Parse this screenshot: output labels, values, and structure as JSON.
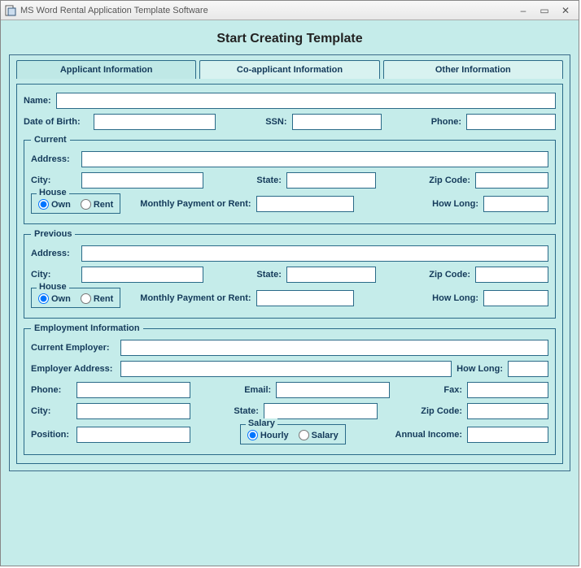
{
  "window_title": "MS Word Rental Application Template Software",
  "heading": "Start Creating Template",
  "tabs": {
    "applicant": "Applicant Information",
    "coapplicant": "Co-applicant Information",
    "other": "Other Information"
  },
  "section_top": {
    "name_label": "Name:",
    "dob_label": "Date of Birth:",
    "ssn_label": "SSN:",
    "phone_label": "Phone:"
  },
  "current": {
    "legend": "Current",
    "address_label": "Address:",
    "city_label": "City:",
    "state_label": "State:",
    "zip_label": "Zip Code:",
    "house_legend": "House",
    "own_label": "Own",
    "rent_label": "Rent",
    "monthly_label": "Monthly Payment or Rent:",
    "howlong_label": "How Long:"
  },
  "previous": {
    "legend": "Previous",
    "address_label": "Address:",
    "city_label": "City:",
    "state_label": "State:",
    "zip_label": "Zip Code:",
    "house_legend": "House",
    "own_label": "Own",
    "rent_label": "Rent",
    "monthly_label": "Monthly Payment or Rent:",
    "howlong_label": "How Long:"
  },
  "employment": {
    "legend": "Employment Information",
    "employer_label": "Current Employer:",
    "emp_address_label": "Employer Address:",
    "howlong_label": "How Long:",
    "phone_label": "Phone:",
    "email_label": "Email:",
    "fax_label": "Fax:",
    "city_label": "City:",
    "state_label": "State:",
    "zip_label": "Zip Code:",
    "position_label": "Position:",
    "salary_legend": "Salary",
    "hourly_label": "Hourly",
    "salary_label": "Salary",
    "annual_label": "Annual Income:"
  }
}
